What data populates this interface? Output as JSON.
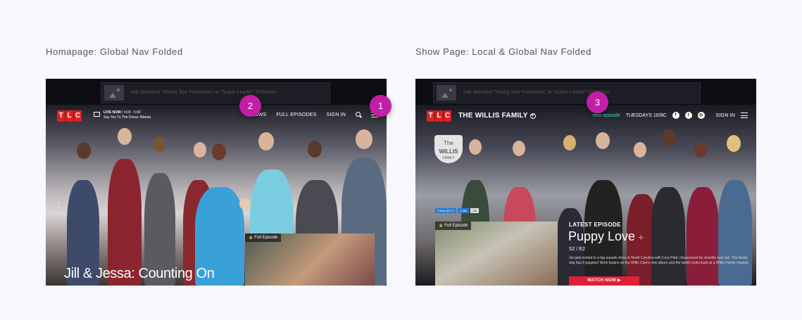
{
  "captions": {
    "left": "Homapage: Global Nav Folded",
    "right": "Show Page: Local & Global Nav Folded"
  },
  "ad_text": "IAB Standard \"Rising Star Pushdown\" or \"Super Leader\" 970x90px",
  "ad_text_right": "IAB Standard \"Rising Star Pushdown\" or \"Super Leader\" 970x90px",
  "logo": {
    "t": "T",
    "l": "L",
    "c": "C"
  },
  "home": {
    "live_label": "LIVE NOW",
    "live_time": "| 4:00 - 5:00",
    "live_show": "Say Yes To The Dress: Atlanta",
    "nav": {
      "shows": "SHOWS",
      "full_episodes": "FULL EPISODES",
      "sign_in": "SIGN IN"
    },
    "show_title": "Jill & Jessa: Counting On",
    "full_episode_badge": "Full Episode"
  },
  "show": {
    "title": "THE WILLIS FAMILY",
    "new_episode": "new episode",
    "airtime": "TUESDAYS 10/9C",
    "sign_in": "SIGN IN",
    "logo_text_1": "The",
    "logo_text_2": "WILLIS",
    "logo_text_3": "FAMILY",
    "share_twitter": "Follow @TLC",
    "share_like": "f Like",
    "share_count": "19k",
    "full_episode_badge": "Full Episode",
    "latest_label": "LATEST EPISODE",
    "latest_title": "Puppy Love",
    "latest_plus": "+",
    "latest_sub": "S2 / E2",
    "latest_desc": "Jet gets invited to a big awards show in North Carolina with Cory Piatt, chaperoned by Jennifer and Jair. The family dog has 9 puppies! Work begins on the Willis Clan's new album and the family looks back at a Willis Family tragedy.",
    "watch_now": "WATCH NOW ▶"
  },
  "markers": {
    "one": "1",
    "two": "2",
    "three": "3"
  },
  "colors": {
    "accent": "#e02020",
    "marker": "#c21fa6",
    "teal": "#3ee0d0"
  }
}
